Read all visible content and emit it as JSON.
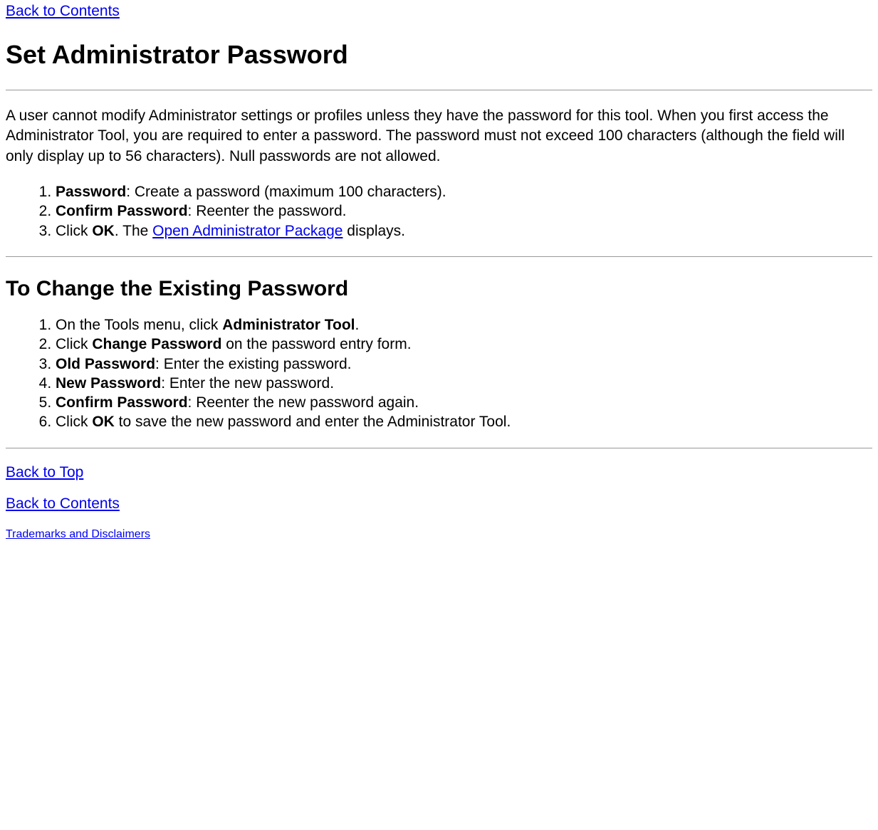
{
  "top_link": "Back to Contents",
  "heading1": "Set Administrator Password",
  "intro_paragraph": "A user cannot modify Administrator settings or profiles unless they have the password for this tool. When you first access the Administrator Tool, you are required to enter a password. The password must not exceed 100 characters (although the field will only display up to 56 characters). Null passwords are not allowed.",
  "list1": {
    "item1_bold": "Password",
    "item1_rest": ": Create a password (maximum 100 characters).",
    "item2_bold": "Confirm Password",
    "item2_rest": ": Reenter the password.",
    "item3_pre": "Click ",
    "item3_bold": "OK",
    "item3_mid": ". The ",
    "item3_link": "Open Administrator Package",
    "item3_end": " displays."
  },
  "heading2": "To Change the Existing Password",
  "list2": {
    "item1_pre": "On the Tools menu, click ",
    "item1_bold": "Administrator Tool",
    "item1_end": ".",
    "item2_pre": "Click ",
    "item2_bold": "Change Password",
    "item2_end": " on the password entry form.",
    "item3_bold": "Old Password",
    "item3_rest": ": Enter the existing password.",
    "item4_bold": "New Password",
    "item4_rest": ": Enter the new password.",
    "item5_bold": "Confirm Password",
    "item5_rest": ": Reenter the new password again.",
    "item6_pre": "Click ",
    "item6_bold": "OK",
    "item6_end": " to save the new password and enter the Administrator Tool."
  },
  "back_to_top": "Back to Top",
  "back_to_contents": "Back to Contents",
  "trademarks": "Trademarks and Disclaimers"
}
